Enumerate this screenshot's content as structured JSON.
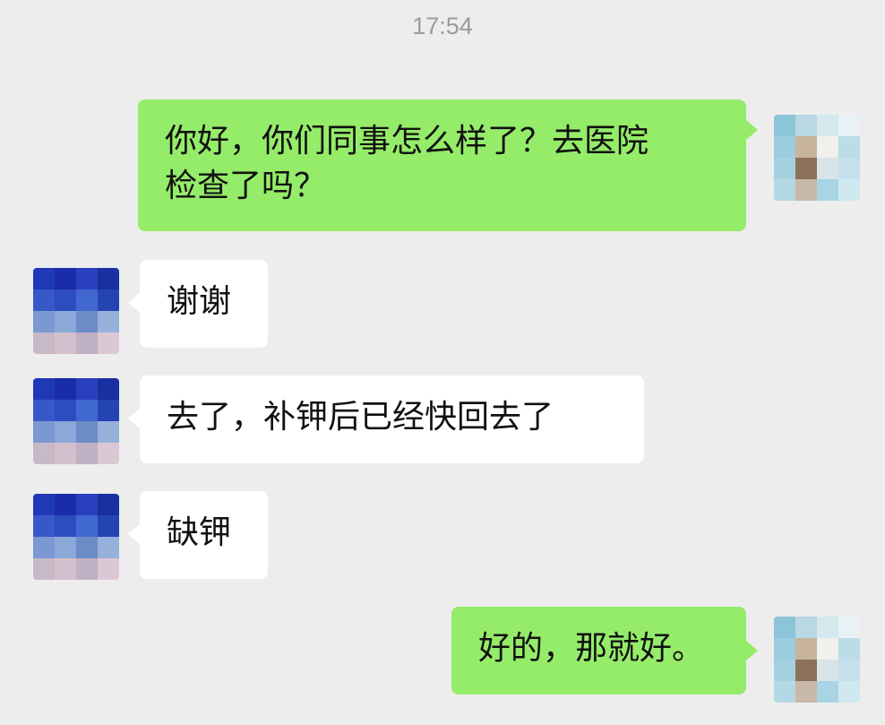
{
  "chat": {
    "timestamp": "17:54",
    "messages": [
      {
        "side": "out",
        "text": "你好，你们同事怎么样了？去医院\n检查了吗？"
      },
      {
        "side": "in",
        "text": "谢谢"
      },
      {
        "side": "in",
        "text": "去了，补钾后已经快回去了"
      },
      {
        "side": "in",
        "text": "缺钾"
      },
      {
        "side": "out",
        "text": "好的，那就好。"
      }
    ]
  },
  "colors": {
    "background": "#ededed",
    "outgoing_bubble": "#95ec69",
    "incoming_bubble": "#ffffff",
    "timestamp_text": "#9b9b9b"
  },
  "avatars": {
    "self": [
      "#8cc4d8",
      "#b8d8e4",
      "#d4e8ee",
      "#e8f2f4",
      "#9ccce0",
      "#c8b49c",
      "#f0f0ec",
      "#bcdce8",
      "#a4d0e0",
      "#8c7058",
      "#d8e4e8",
      "#c4e0ec",
      "#b4d8e6",
      "#c8b8a8",
      "#a8d4e4",
      "#d0e8f0"
    ],
    "contact": [
      "#2038b8",
      "#1a2ca8",
      "#2840c0",
      "#1830a0",
      "#3858c8",
      "#2c4cc0",
      "#4068d0",
      "#2444b4",
      "#7c98d0",
      "#8aa8d8",
      "#6c8cc8",
      "#98b0dc",
      "#c8b8c8",
      "#d4c0cc",
      "#c0b0c4",
      "#dcc8d4"
    ]
  }
}
